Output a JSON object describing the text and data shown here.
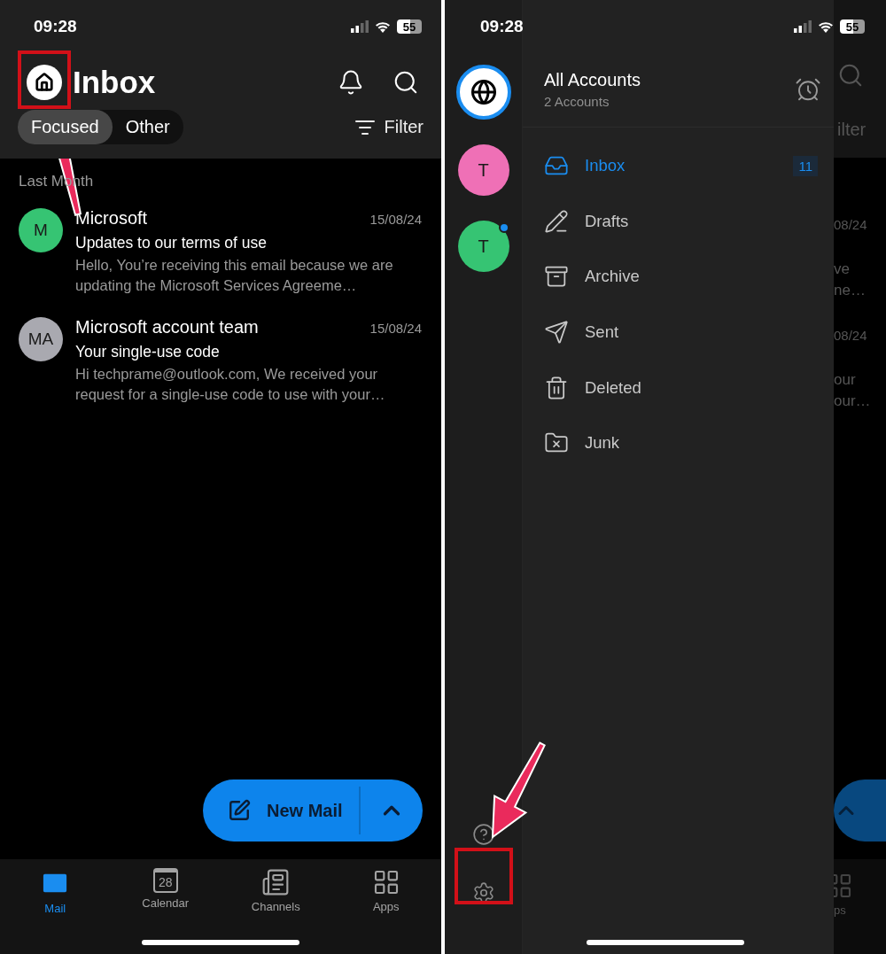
{
  "left_phone": {
    "status_bar": {
      "time": "09:28",
      "battery": "55"
    },
    "header": {
      "title": "Inbox"
    },
    "view_tabs": [
      {
        "label": "Focused",
        "selected": true
      },
      {
        "label": "Other",
        "selected": false
      }
    ],
    "filter": {
      "label": "Filter"
    },
    "section": "Last Month",
    "messages": [
      {
        "initials": "M",
        "color": "#36c473",
        "sender": "Microsoft",
        "date": "15/08/24",
        "subject": "Updates to our terms of use",
        "preview": "Hello, You’re receiving this email because we are updating the Microsoft Services Agreeme…"
      },
      {
        "initials": "MA",
        "color": "#a9a9b0",
        "sender": "Microsoft account team",
        "date": "15/08/24",
        "subject": "Your single-use code",
        "preview": "Hi techprame@outlook.com, We received your request for a single-use code to use with your…"
      }
    ],
    "new_mail": {
      "label": "New Mail"
    },
    "tab_bar": [
      {
        "kind": "mail",
        "label": "Mail",
        "selected": true
      },
      {
        "kind": "calendar",
        "label": "Calendar",
        "selected": false,
        "icon_text": "28"
      },
      {
        "kind": "channels",
        "label": "Channels",
        "selected": false
      },
      {
        "kind": "apps",
        "label": "Apps",
        "selected": false
      }
    ]
  },
  "right_phone": {
    "status_bar": {
      "time": "09:28",
      "battery": "55"
    },
    "accounts": [
      {
        "kind": "all",
        "selected": true
      },
      {
        "kind": "account",
        "initials": "T",
        "color": "#ef70b6",
        "selected": false,
        "unread": false
      },
      {
        "kind": "account",
        "initials": "T",
        "color": "#36c473",
        "selected": false,
        "unread": true
      }
    ],
    "drawer": {
      "title": "All Accounts",
      "subtitle": "2 Accounts"
    },
    "folders": [
      {
        "kind": "inbox",
        "label": "Inbox",
        "selected": true,
        "count": "11"
      },
      {
        "kind": "drafts",
        "label": "Drafts",
        "selected": false
      },
      {
        "kind": "archive",
        "label": "Archive",
        "selected": false
      },
      {
        "kind": "sent",
        "label": "Sent",
        "selected": false
      },
      {
        "kind": "deleted",
        "label": "Deleted",
        "selected": false
      },
      {
        "kind": "junk",
        "label": "Junk",
        "selected": false
      }
    ],
    "behind": {
      "filter": "ilter",
      "rows": [
        {
          "date": "08/24",
          "preview": [
            "ve",
            "ne…"
          ]
        },
        {
          "date": "08/24",
          "preview": [
            "our",
            "our…"
          ]
        }
      ],
      "tab": "ps"
    }
  }
}
